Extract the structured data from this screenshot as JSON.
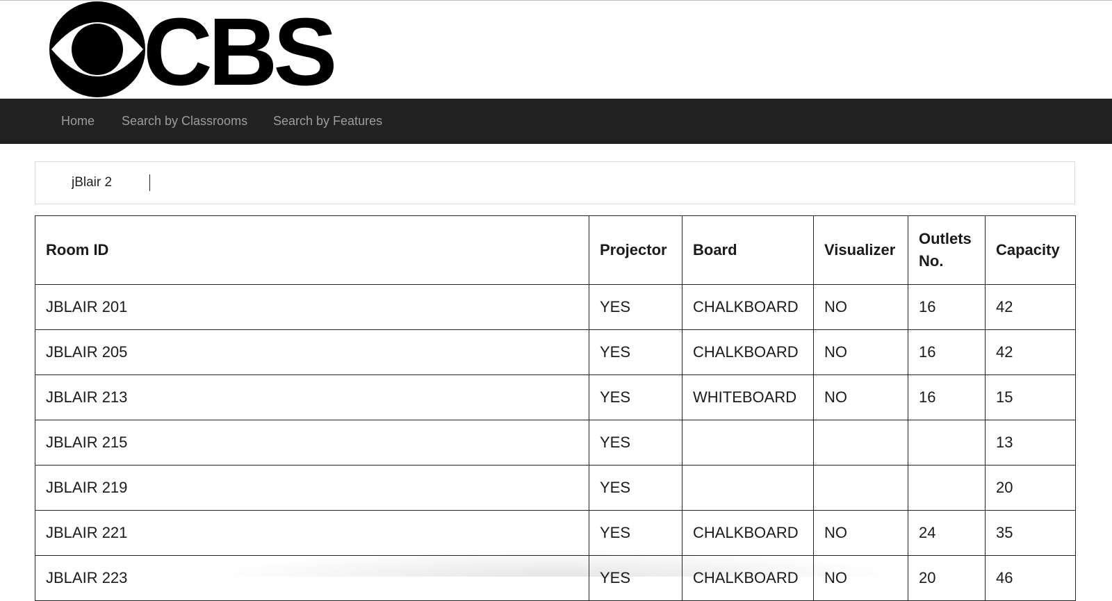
{
  "logo": {
    "text": "CBS",
    "icon": "cbs-eye-logo"
  },
  "nav": {
    "items": [
      {
        "label": "Home"
      },
      {
        "label": "Search by Classrooms"
      },
      {
        "label": "Search by Features"
      }
    ]
  },
  "search": {
    "value": "jBlair 2",
    "placeholder": ""
  },
  "table": {
    "headers": {
      "room_id": "Room ID",
      "projector": "Projector",
      "board": "Board",
      "visualizer": "Visualizer",
      "outlets": "Outlets No.",
      "capacity": "Capacity"
    },
    "rows": [
      {
        "room_id": "JBLAIR 201",
        "projector": "YES",
        "board": "CHALKBOARD",
        "visualizer": "NO",
        "outlets": "16",
        "capacity": "42"
      },
      {
        "room_id": "JBLAIR 205",
        "projector": "YES",
        "board": "CHALKBOARD",
        "visualizer": "NO",
        "outlets": "16",
        "capacity": "42"
      },
      {
        "room_id": "JBLAIR 213",
        "projector": "YES",
        "board": "WHITEBOARD",
        "visualizer": "NO",
        "outlets": "16",
        "capacity": "15"
      },
      {
        "room_id": "JBLAIR 215",
        "projector": "YES",
        "board": "",
        "visualizer": "",
        "outlets": "",
        "capacity": "13"
      },
      {
        "room_id": "JBLAIR 219",
        "projector": "YES",
        "board": "",
        "visualizer": "",
        "outlets": "",
        "capacity": "20"
      },
      {
        "room_id": "JBLAIR 221",
        "projector": "YES",
        "board": "CHALKBOARD",
        "visualizer": "NO",
        "outlets": "24",
        "capacity": "35"
      },
      {
        "room_id": "JBLAIR 223",
        "projector": "YES",
        "board": "CHALKBOARD",
        "visualizer": "NO",
        "outlets": "20",
        "capacity": "46"
      }
    ]
  },
  "colors": {
    "navbar_bg": "#222222",
    "nav_text": "#9d9d9d",
    "border": "#222222"
  }
}
